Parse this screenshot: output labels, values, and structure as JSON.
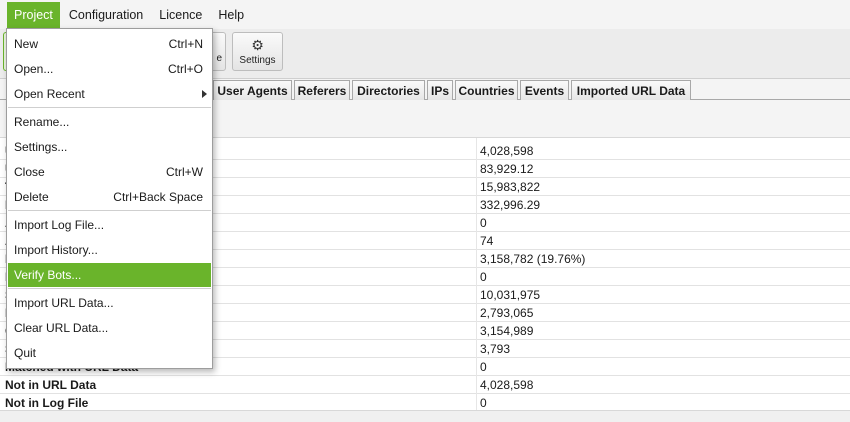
{
  "menubar": {
    "items": [
      "Project",
      "Configuration",
      "Licence",
      "Help"
    ]
  },
  "toolbar": {
    "partial_label": "e",
    "settings_label": "Settings",
    "settings_icon": "gear-icon"
  },
  "tabs": [
    "User Agents",
    "Referers",
    "Directories",
    "IPs",
    "Countries",
    "Events",
    "Imported URL Data"
  ],
  "rows": [
    {
      "label": "U",
      "value": "4,028,598"
    },
    {
      "label": "U",
      "value": "83,929.12"
    },
    {
      "label": "T",
      "value": "15,983,822"
    },
    {
      "label": "I",
      "value": "332,996.29"
    },
    {
      "label": "A",
      "value": "0"
    },
    {
      "label": "A",
      "value": "74"
    },
    {
      "label": "I",
      "value": "3,158,782 (19.76%)"
    },
    {
      "label": "I",
      "value": "0"
    },
    {
      "label": "S",
      "value": "10,031,975"
    },
    {
      "label": "I",
      "value": "2,793,065"
    },
    {
      "label": "C",
      "value": "3,154,989"
    },
    {
      "label": "S",
      "value": "3,793"
    },
    {
      "label": "Matched with URL Data",
      "value": "0"
    },
    {
      "label": "Not in URL Data",
      "value": "4,028,598"
    },
    {
      "label": "Not in Log File",
      "value": "0"
    }
  ],
  "project_menu": {
    "new": {
      "label": "New",
      "shortcut": "Ctrl+N"
    },
    "open": {
      "label": "Open...",
      "shortcut": "Ctrl+O"
    },
    "open_recent": {
      "label": "Open Recent"
    },
    "rename": {
      "label": "Rename..."
    },
    "settings": {
      "label": "Settings..."
    },
    "close": {
      "label": "Close",
      "shortcut": "Ctrl+W"
    },
    "delete": {
      "label": "Delete",
      "shortcut": "Ctrl+Back Space"
    },
    "import_log": {
      "label": "Import Log File..."
    },
    "import_history": {
      "label": "Import History..."
    },
    "verify_bots": {
      "label": "Verify Bots..."
    },
    "import_url": {
      "label": "Import URL Data..."
    },
    "clear_url": {
      "label": "Clear URL Data..."
    },
    "quit": {
      "label": "Quit"
    }
  },
  "colors": {
    "accent": "#6ab42b"
  }
}
